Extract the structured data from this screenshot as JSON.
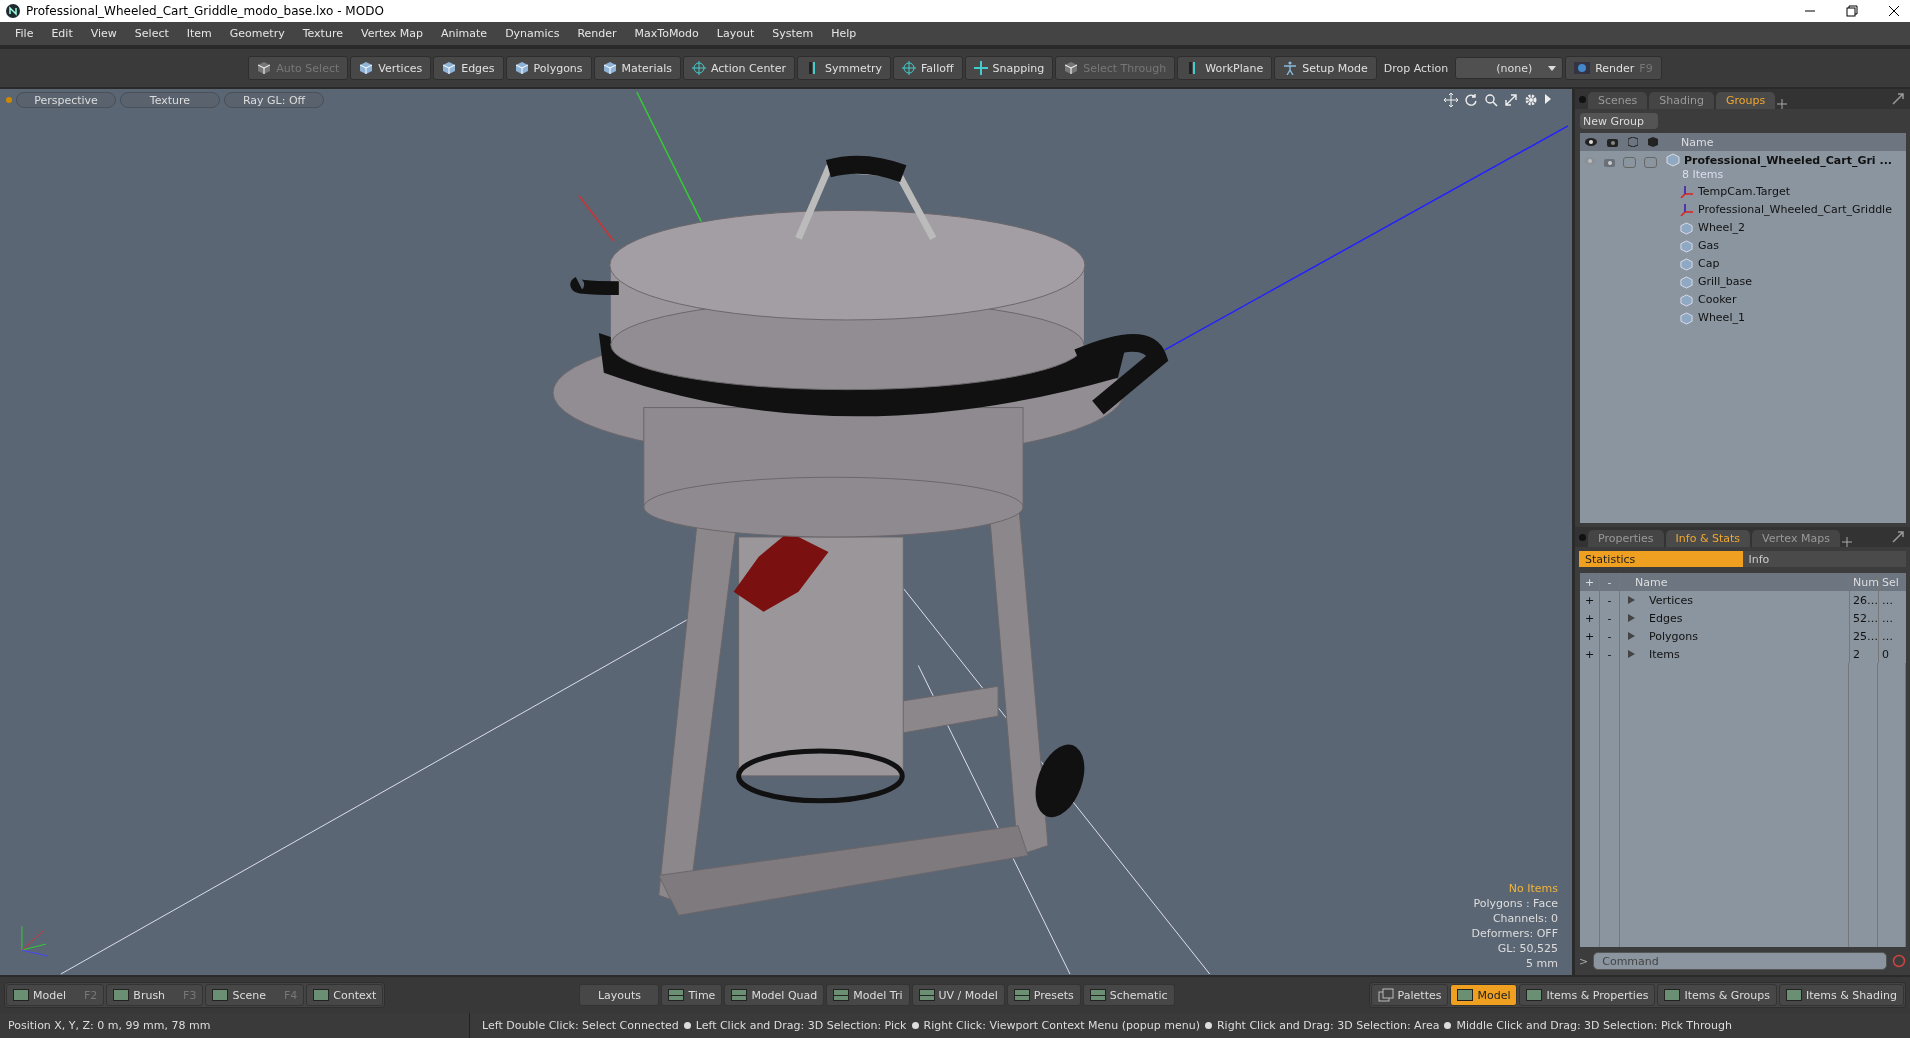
{
  "window": {
    "title": "Professional_Wheeled_Cart_Griddle_modo_base.lxo - MODO"
  },
  "menu": [
    "File",
    "Edit",
    "View",
    "Select",
    "Item",
    "Geometry",
    "Texture",
    "Vertex Map",
    "Animate",
    "Dynamics",
    "Render",
    "MaxToModo",
    "Layout",
    "System",
    "Help"
  ],
  "toolbar": {
    "items": [
      {
        "label": "Auto Select",
        "disabled": true
      },
      {
        "label": "Vertices",
        "disabled": false
      },
      {
        "label": "Edges",
        "disabled": false
      },
      {
        "label": "Polygons",
        "disabled": false
      },
      {
        "label": "Materials",
        "disabled": false
      },
      {
        "label": "Action Center",
        "disabled": false
      },
      {
        "label": "Symmetry",
        "disabled": false
      },
      {
        "label": "Falloff",
        "disabled": false
      },
      {
        "label": "Snapping",
        "disabled": false
      },
      {
        "label": "Select Through",
        "disabled": true
      },
      {
        "label": "WorkPlane",
        "disabled": false
      },
      {
        "label": "Setup Mode",
        "disabled": false
      }
    ],
    "drop_action": {
      "label": "Drop Action",
      "value": "(none)"
    },
    "render": {
      "label": "Render",
      "hotkey": "F9"
    }
  },
  "viewport": {
    "tabs": [
      "Perspective",
      "Texture",
      "Ray GL: Off"
    ],
    "info": [
      {
        "text": "No Items",
        "highlighted": true
      },
      {
        "text": "Polygons : Face",
        "highlighted": false
      },
      {
        "text": "Channels: 0",
        "highlighted": false
      },
      {
        "text": "Deformers: OFF",
        "highlighted": false
      },
      {
        "text": "GL: 50,525",
        "highlighted": false
      },
      {
        "text": "5 mm",
        "highlighted": false
      }
    ]
  },
  "scene_panel": {
    "tabs": [
      {
        "label": "Scenes",
        "selected": false
      },
      {
        "label": "Shading",
        "selected": false
      },
      {
        "label": "Groups",
        "selected": true
      }
    ],
    "new_group": "New Group",
    "name_column": "Name",
    "root": {
      "name": "Professional_Wheeled_Cart_Gri ...",
      "count": "8 Items",
      "toggles": [
        {
          "on": false
        },
        {
          "on": false
        }
      ],
      "children": [
        {
          "name": "TempCam.Target",
          "kind": "locator"
        },
        {
          "name": "Professional_Wheeled_Cart_Griddle",
          "kind": "locator"
        },
        {
          "name": "Wheel_2",
          "kind": "mesh"
        },
        {
          "name": "Gas",
          "kind": "mesh"
        },
        {
          "name": "Cap",
          "kind": "mesh"
        },
        {
          "name": "Grill_base",
          "kind": "mesh"
        },
        {
          "name": "Cooker",
          "kind": "mesh"
        },
        {
          "name": "Wheel_1",
          "kind": "mesh"
        }
      ]
    }
  },
  "stats_panel": {
    "tabs": [
      {
        "label": "Properties",
        "selected": false
      },
      {
        "label": "Info & Stats",
        "selected": true
      },
      {
        "label": "Vertex Maps",
        "selected": false
      }
    ],
    "subtabs": [
      {
        "label": "Statistics",
        "selected": true
      },
      {
        "label": "Info",
        "selected": false
      }
    ],
    "columns": [
      "+",
      "-",
      "Name",
      "Num",
      "Sel"
    ],
    "rows": [
      {
        "add": "+",
        "remove": "-",
        "name": "Vertices",
        "num": "26…",
        "sel": "…"
      },
      {
        "add": "+",
        "remove": "-",
        "name": "Edges",
        "num": "52…",
        "sel": "…"
      },
      {
        "add": "+",
        "remove": "-",
        "name": "Polygons",
        "num": "25…",
        "sel": "…"
      },
      {
        "add": "+",
        "remove": "-",
        "name": "Items",
        "num": "2",
        "sel": "0"
      }
    ],
    "command_prompt": ">",
    "command_placeholder": "Command"
  },
  "bottom_bar": {
    "left": [
      {
        "label": "Model",
        "hotkey": "F2"
      },
      {
        "label": "Brush",
        "hotkey": "F3"
      },
      {
        "label": "Scene",
        "hotkey": "F4"
      },
      {
        "label": "Context"
      }
    ],
    "layouts": "Layouts",
    "center": [
      "Time",
      "Model Quad",
      "Model Tri",
      "UV / Model",
      "Presets",
      "Schematic"
    ],
    "palettes": "Palettes",
    "right": [
      {
        "label": "Model",
        "selected": true
      },
      {
        "label": "Items & Properties",
        "selected": false
      },
      {
        "label": "Items & Groups",
        "selected": false
      },
      {
        "label": "Items & Shading",
        "selected": false
      }
    ]
  },
  "status_bar": {
    "position": "Position X, Y, Z:   0 m, 99 mm, 78 mm",
    "hints": [
      "Left Double Click: Select Connected",
      "Left Click and Drag: 3D Selection: Pick",
      "Right Click: Viewport Context Menu (popup menu)",
      "Right Click and Drag: 3D Selection: Area",
      "Middle Click and Drag: 3D Selection: Pick Through"
    ]
  }
}
